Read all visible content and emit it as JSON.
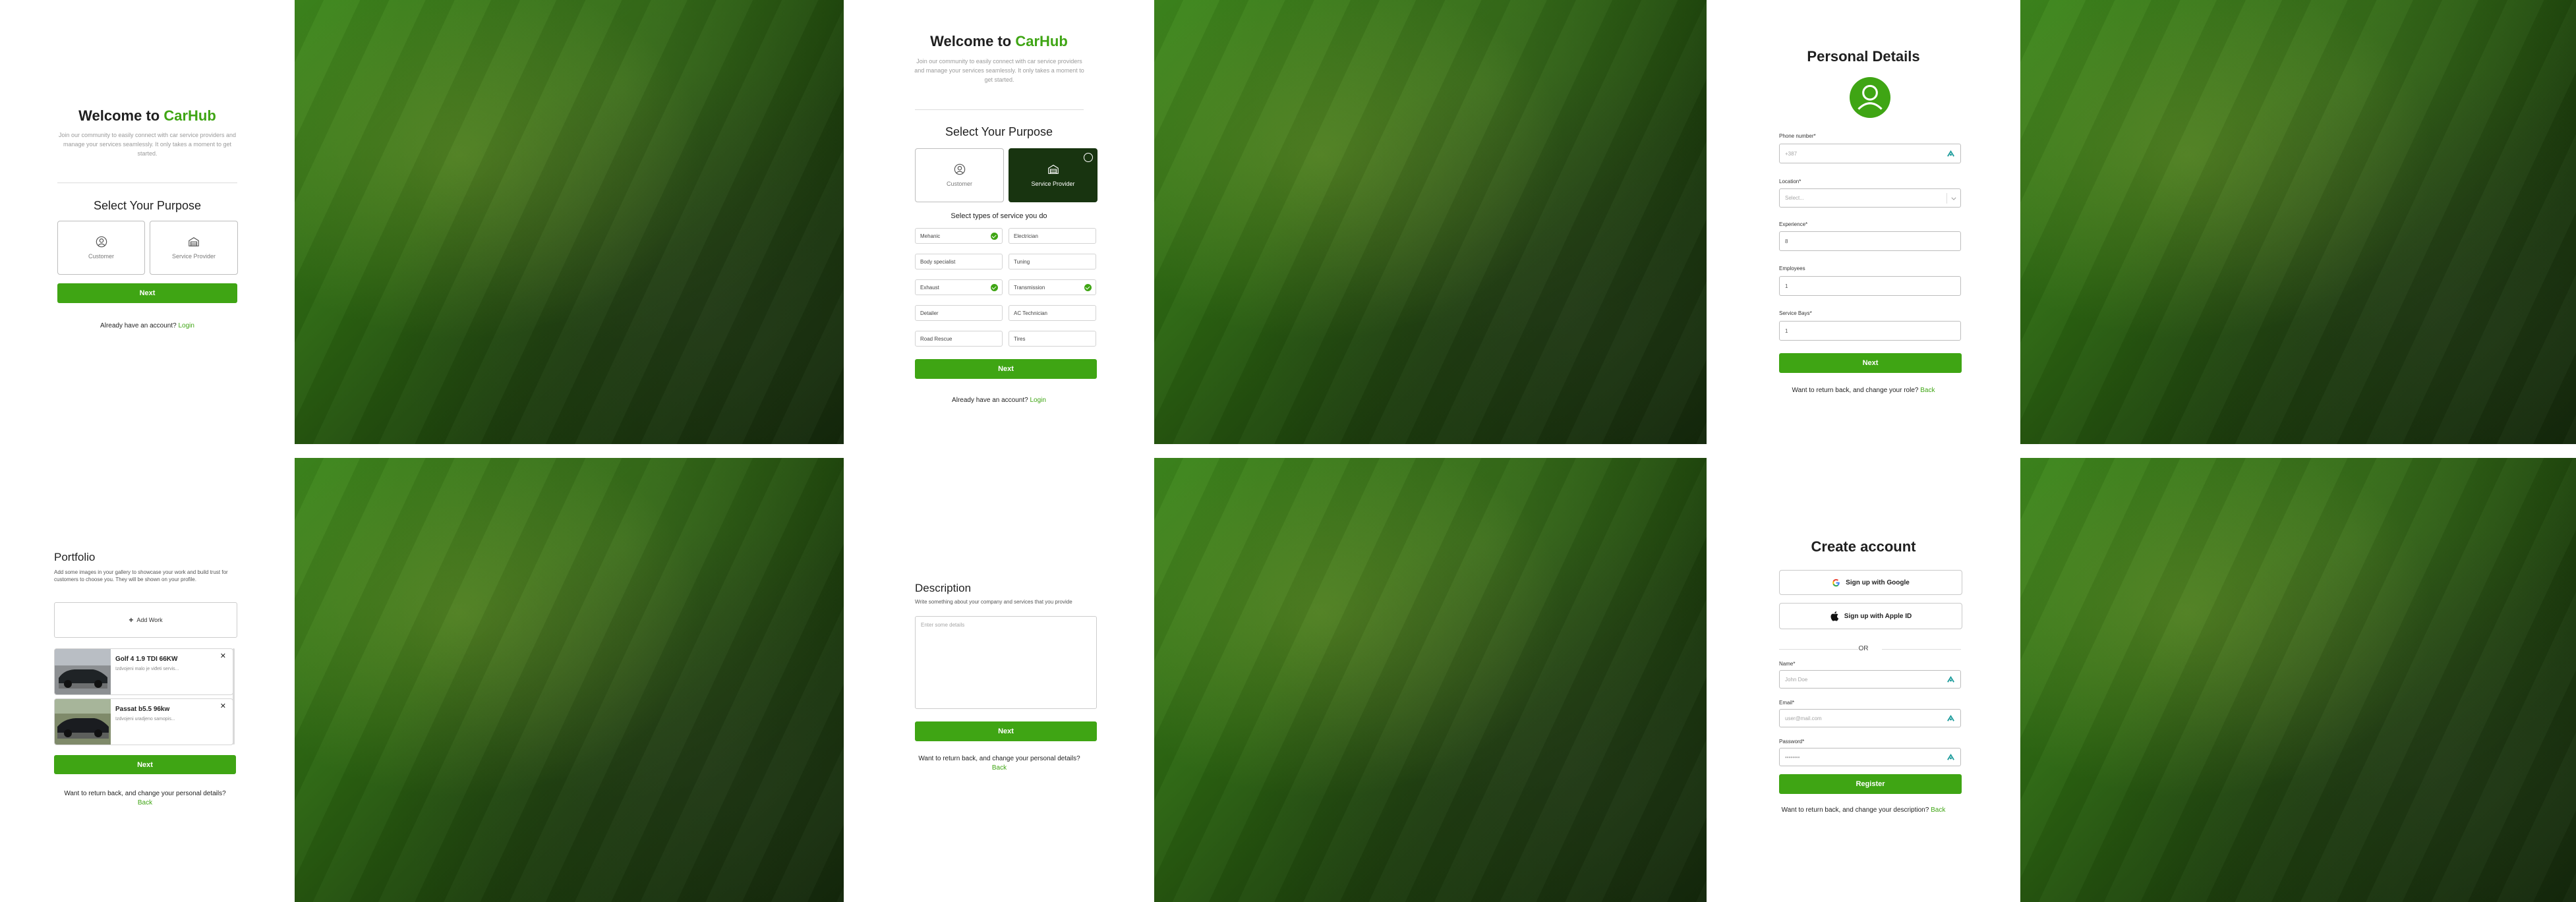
{
  "brand": {
    "welcome": "Welcome to",
    "name": "CarHub"
  },
  "intro": "Join our community to easily connect with car service providers and manage your services seamlessly. It only takes a moment to get started.",
  "purpose": {
    "title": "Select Your Purpose",
    "customer": "Customer",
    "provider": "Service Provider"
  },
  "common": {
    "next": "Next",
    "have_account": "Already have an account?",
    "login": "Login",
    "back": "Back"
  },
  "services": {
    "title": "Select types of service you do",
    "items": [
      {
        "label": "Mehanic",
        "checked": true
      },
      {
        "label": "Electrician",
        "checked": false
      },
      {
        "label": "Body specialist",
        "checked": false
      },
      {
        "label": "Tuning",
        "checked": false
      },
      {
        "label": "Exhaust",
        "checked": true
      },
      {
        "label": "Transmission",
        "checked": true
      },
      {
        "label": "Detailer",
        "checked": false
      },
      {
        "label": "AC Technician",
        "checked": false
      },
      {
        "label": "Road Rescue",
        "checked": false
      },
      {
        "label": "Tires",
        "checked": false
      }
    ]
  },
  "personal": {
    "title": "Personal Details",
    "phone_label": "Phone number*",
    "phone_value": "+387",
    "location_label": "Location*",
    "location_value": "Select...",
    "experience_label": "Experience*",
    "experience_value": "8",
    "employees_label": "Employees",
    "employees_value": "1",
    "bays_label": "Service Bays*",
    "bays_value": "1",
    "footer": "Want to return back, and change your role?"
  },
  "portfolio": {
    "title": "Portfolio",
    "desc": "Add some images in your gallery to showcase your work and build trust for customers to choose you. They will be shown on your profile.",
    "add_work": "Add Work",
    "items": [
      {
        "title": "Golf 4 1.9 TDI 66KW",
        "sub": "Izdvojeni malo je viđeti servis..."
      },
      {
        "title": "Passat b5.5 96kw",
        "sub": "Izdvojeni uradjeno samopis..."
      }
    ],
    "footer": "Want to return back, and change your personal details?"
  },
  "description": {
    "title": "Description",
    "desc": "Write something about your company and services that you provide",
    "placeholder": "Enter some details",
    "footer": "Want to return back, and change your personal details?"
  },
  "create": {
    "title": "Create account",
    "google": "Sign up with Google",
    "apple": "Sign up with Apple ID",
    "or": "OR",
    "name_label": "Name*",
    "name_ph": "John Doe",
    "email_label": "Email*",
    "email_ph": "user@mail.com",
    "password_label": "Password*",
    "password_ph": "••••••••",
    "register": "Register",
    "footer": "Want to return back, and change your description?"
  },
  "colors": {
    "accent": "#3fa514",
    "selected_card": "#183410"
  }
}
